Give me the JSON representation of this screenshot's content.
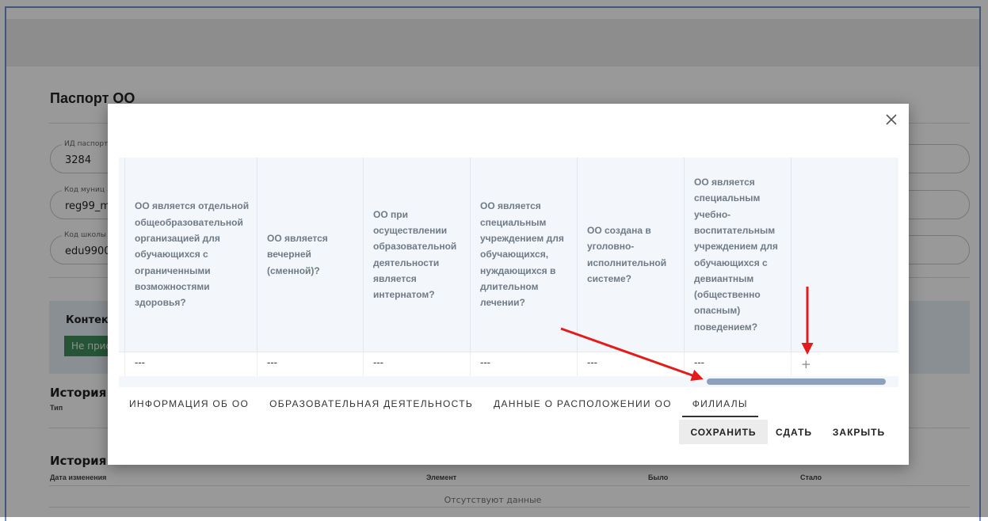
{
  "page": {
    "title": "Паспорт ОО",
    "fields": [
      {
        "label": "ИД паспорт",
        "value": "3284"
      },
      {
        "label": "Код муниц",
        "value": "reg99_m"
      },
      {
        "label": "Код школы",
        "value": "edu9900"
      }
    ],
    "context_title": "Контекс",
    "context_badge": "Не прис",
    "history_titles": [
      "История и",
      "История и"
    ],
    "history1_col": "Тип",
    "history2_cols": [
      "Дата изменения",
      "Элемент",
      "Было",
      "Стало"
    ],
    "no_data": "Отсутствуют данные"
  },
  "modal": {
    "headers": [
      "",
      "ОО является отдельной общеобразовательной организацией для обучающихся с ограниченными возможностями здоровья?",
      "ОО является вечерней (сменной)?",
      "ОО при осуществлении образовательной деятельности является интернатом?",
      "ОО является специальным учреждением для обучающихся, нуждающихся в длительном лечении?",
      "ОО создана в уголовно-исполнительной системе?",
      "ОО является специальным учебно-воспитательным учреждением для обучающихся с девиантным (общественно опасным) поведением?",
      ""
    ],
    "row": [
      "",
      "---",
      "---",
      "---",
      "---",
      "---",
      "---"
    ],
    "add_symbol": "+",
    "tabs": [
      {
        "label": "ИНФОРМАЦИЯ ОБ ОО",
        "active": false
      },
      {
        "label": "ОБРАЗОВАТЕЛЬНАЯ ДЕЯТЕЛЬНОСТЬ",
        "active": false
      },
      {
        "label": "ДАННЫЕ О РАСПОЛОЖЕНИИ ОО",
        "active": false
      },
      {
        "label": "ФИЛИАЛЫ",
        "active": true
      }
    ],
    "buttons": {
      "save": "СОХРАНИТЬ",
      "submit": "СДАТЬ",
      "close": "ЗАКРЫТЬ"
    }
  },
  "icons": {
    "close": "close-icon",
    "arrow": "red-arrow-annotation"
  },
  "colors": {
    "accent_arrow": "#e41b1b",
    "scroll_thumb": "#8ca1be",
    "badge": "#3f8e5a"
  }
}
